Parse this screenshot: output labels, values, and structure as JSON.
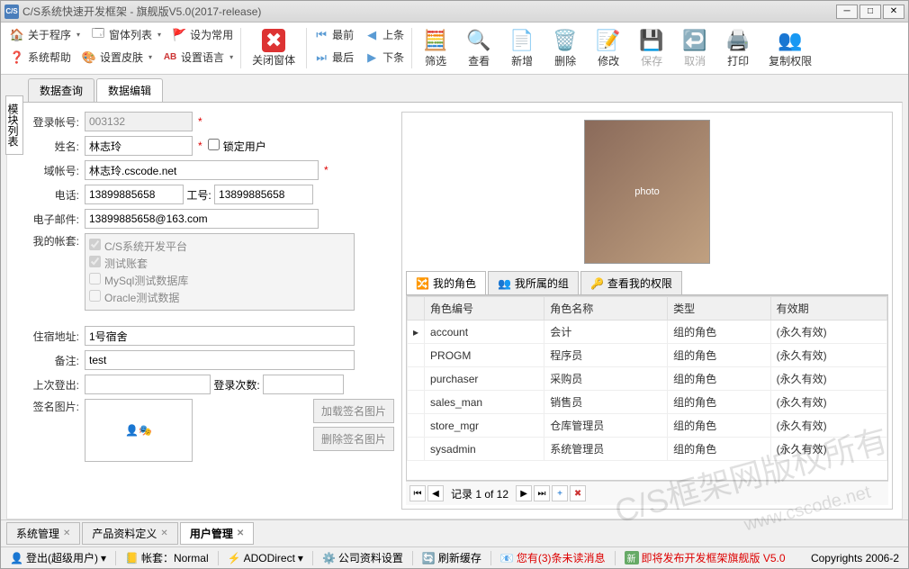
{
  "title": "C/S系统快速开发框架 - 旗舰版V5.0(2017-release)",
  "menu": {
    "about": "关于程序",
    "winlist": "窗体列表",
    "setfav": "设为常用",
    "help": "系统帮助",
    "skin": "设置皮肤",
    "lang": "设置语言",
    "close_win": "关闭窗体",
    "first": "最前",
    "prev": "上条",
    "last": "最后",
    "next": "下条"
  },
  "tools": {
    "filter": "筛选",
    "view": "查看",
    "add": "新增",
    "delete": "删除",
    "edit": "修改",
    "save": "保存",
    "cancel": "取消",
    "print": "打印",
    "copyperm": "复制权限"
  },
  "side_tab": "模块列表",
  "tabs": {
    "query": "数据查询",
    "edit": "数据编辑"
  },
  "form": {
    "lbl_account": "登录帐号:",
    "account": "003132",
    "lbl_name": "姓名:",
    "name": "林志玲",
    "lock_user": "锁定用户",
    "lbl_domain": "域帐号:",
    "domain": "林志玲.cscode.net",
    "lbl_phone": "电话:",
    "phone": "13899885658",
    "lbl_workno": "工号:",
    "workno": "13899885658",
    "lbl_email": "电子邮件:",
    "email": "13899885658@163.com",
    "lbl_accounts": "我的帐套:",
    "accounts": [
      "C/S系统开发平台",
      "测试账套",
      "MySql测试数据库",
      "Oracle测试数据"
    ],
    "lbl_addr": "住宿地址:",
    "addr": "1号宿舍",
    "lbl_remark": "备注:",
    "remark": "test",
    "lbl_lastlogin": "上次登出:",
    "lastlogin": "",
    "lbl_logincount": "登录次数:",
    "logincount": "",
    "lbl_sign": "签名图片:",
    "btn_load_sign": "加载签名图片",
    "btn_del_sign": "删除签名图片"
  },
  "sub_tabs": {
    "roles": "我的角色",
    "groups": "我所属的组",
    "perms": "查看我的权限"
  },
  "grid": {
    "cols": {
      "code": "角色编号",
      "name": "角色名称",
      "type": "类型",
      "valid": "有效期"
    },
    "rows": [
      {
        "code": "account",
        "name": "会计",
        "type": "组的角色",
        "valid": "(永久有效)"
      },
      {
        "code": "PROGM",
        "name": "程序员",
        "type": "组的角色",
        "valid": "(永久有效)"
      },
      {
        "code": "purchaser",
        "name": "采购员",
        "type": "组的角色",
        "valid": "(永久有效)"
      },
      {
        "code": "sales_man",
        "name": "销售员",
        "type": "组的角色",
        "valid": "(永久有效)"
      },
      {
        "code": "store_mgr",
        "name": "仓库管理员",
        "type": "组的角色",
        "valid": "(永久有效)"
      },
      {
        "code": "sysadmin",
        "name": "系统管理员",
        "type": "组的角色",
        "valid": "(永久有效)"
      }
    ],
    "nav_text": "记录 1 of 12"
  },
  "bottom_tabs": {
    "sys": "系统管理",
    "product": "产品资料定义",
    "user": "用户管理"
  },
  "status": {
    "logout": "登出(超级用户)",
    "account_set": "帐套：Normal",
    "ado": "ADODirect",
    "company": "公司资料设置",
    "refresh": "刷新缓存",
    "unread": "您有(3)条未读消息",
    "release": "即将发布开发框架旗舰版 V5.0",
    "copyright": "Copyrights 2006-2"
  },
  "watermark": "C/S框架网版权所有",
  "watermark_sub": "www.cscode.net"
}
